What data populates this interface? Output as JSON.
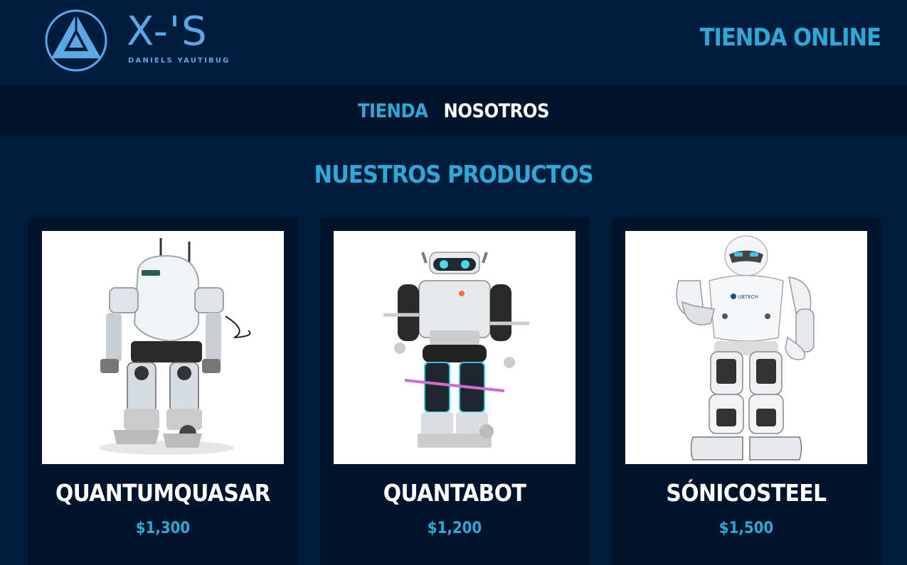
{
  "header": {
    "logo_text": "X-'S",
    "logo_subtitle": "DANIELS YAUTIBUG",
    "store_title": "TIENDA ONLINE"
  },
  "nav": {
    "items": [
      {
        "label": "TIENDA",
        "active": true
      },
      {
        "label": "NOSOTROS",
        "active": false
      }
    ]
  },
  "main": {
    "section_title": "NUESTROS PRODUCTOS",
    "products": [
      {
        "name": "QUANTUMQUASAR",
        "price": "$1,300",
        "image": "robot-image"
      },
      {
        "name": "QUANTABOT",
        "price": "$1,200",
        "image": "robot-image"
      },
      {
        "name": "SÓNICOSTEEL",
        "price": "$1,500",
        "image": "robot-image"
      }
    ]
  },
  "colors": {
    "background": "#001d3d",
    "nav_background": "#00152b",
    "card_background": "#00152b",
    "accent": "#2fa8d5",
    "logo": "#5aa9e6",
    "text": "#ffffff"
  }
}
